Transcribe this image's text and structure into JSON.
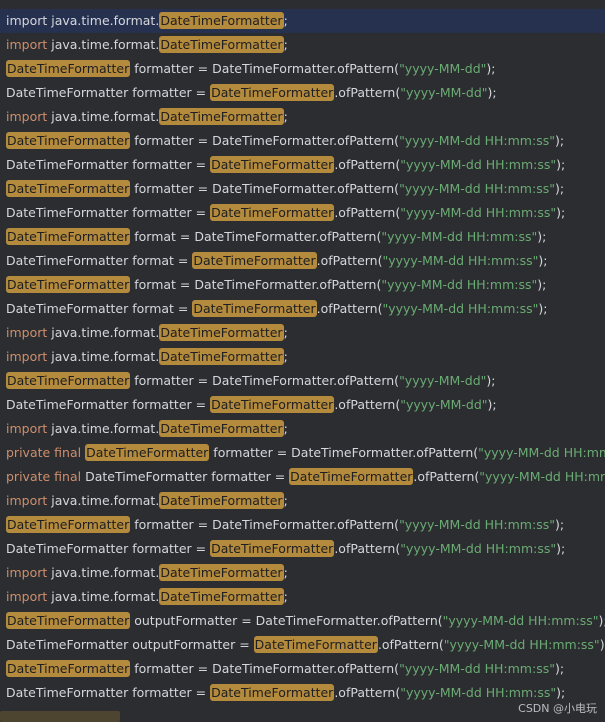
{
  "colors": {
    "background": "#2b2d30",
    "selection": "#263150",
    "keyword": "#cf8e6d",
    "plain": "#d4d7dc",
    "string": "#6aab73",
    "match_highlight": "#b48a3c"
  },
  "watermark": "CSDN @小电玩",
  "lines": [
    [
      {
        "t": "import java.time.format",
        "c": "plain"
      },
      {
        "t": ".",
        "c": "plain"
      },
      {
        "t": "DateTimeFormatter",
        "c": "hl"
      },
      {
        "t": ";",
        "c": "plain"
      }
    ],
    [
      {
        "t": "import",
        "c": "kw"
      },
      {
        "t": " java.time.format",
        "c": "plain"
      },
      {
        "t": ".",
        "c": "plain"
      },
      {
        "t": "DateTimeFormatter",
        "c": "hl"
      },
      {
        "t": ";",
        "c": "plain"
      }
    ],
    [
      {
        "t": "DateTimeFormatter",
        "c": "hl"
      },
      {
        "t": " formatter = DateTimeFormatter.ofPattern(",
        "c": "plain"
      },
      {
        "t": "\"yyyy-MM-dd\"",
        "c": "str"
      },
      {
        "t": ");",
        "c": "plain"
      }
    ],
    [
      {
        "t": "DateTimeFormatter formatter = ",
        "c": "plain"
      },
      {
        "t": "DateTimeFormatter",
        "c": "hl"
      },
      {
        "t": ".ofPattern(",
        "c": "plain"
      },
      {
        "t": "\"yyyy-MM-dd\"",
        "c": "str"
      },
      {
        "t": ");",
        "c": "plain"
      }
    ],
    [
      {
        "t": "import",
        "c": "kw"
      },
      {
        "t": " java.time.format",
        "c": "plain"
      },
      {
        "t": ".",
        "c": "plain"
      },
      {
        "t": "DateTimeFormatter",
        "c": "hl"
      },
      {
        "t": ";",
        "c": "plain"
      }
    ],
    [
      {
        "t": "DateTimeFormatter",
        "c": "hl"
      },
      {
        "t": " formatter = DateTimeFormatter.ofPattern(",
        "c": "plain"
      },
      {
        "t": "\"yyyy-MM-dd HH:mm:ss\"",
        "c": "str"
      },
      {
        "t": ");",
        "c": "plain"
      }
    ],
    [
      {
        "t": "DateTimeFormatter formatter = ",
        "c": "plain"
      },
      {
        "t": "DateTimeFormatter",
        "c": "hl"
      },
      {
        "t": ".ofPattern(",
        "c": "plain"
      },
      {
        "t": "\"yyyy-MM-dd HH:mm:ss\"",
        "c": "str"
      },
      {
        "t": ");",
        "c": "plain"
      }
    ],
    [
      {
        "t": "DateTimeFormatter",
        "c": "hl"
      },
      {
        "t": " formatter = DateTimeFormatter.ofPattern(",
        "c": "plain"
      },
      {
        "t": "\"yyyy-MM-dd HH:mm:ss\"",
        "c": "str"
      },
      {
        "t": ");",
        "c": "plain"
      }
    ],
    [
      {
        "t": "DateTimeFormatter formatter = ",
        "c": "plain"
      },
      {
        "t": "DateTimeFormatter",
        "c": "hl"
      },
      {
        "t": ".ofPattern(",
        "c": "plain"
      },
      {
        "t": "\"yyyy-MM-dd HH:mm:ss\"",
        "c": "str"
      },
      {
        "t": ");",
        "c": "plain"
      }
    ],
    [
      {
        "t": "DateTimeFormatter",
        "c": "hl"
      },
      {
        "t": " format = DateTimeFormatter.ofPattern(",
        "c": "plain"
      },
      {
        "t": "\"yyyy-MM-dd HH:mm:ss\"",
        "c": "str"
      },
      {
        "t": ");",
        "c": "plain"
      }
    ],
    [
      {
        "t": "DateTimeFormatter format = ",
        "c": "plain"
      },
      {
        "t": "DateTimeFormatter",
        "c": "hl"
      },
      {
        "t": ".ofPattern(",
        "c": "plain"
      },
      {
        "t": "\"yyyy-MM-dd HH:mm:ss\"",
        "c": "str"
      },
      {
        "t": ");",
        "c": "plain"
      }
    ],
    [
      {
        "t": "DateTimeFormatter",
        "c": "hl"
      },
      {
        "t": " format = DateTimeFormatter.ofPattern(",
        "c": "plain"
      },
      {
        "t": "\"yyyy-MM-dd HH:mm:ss\"",
        "c": "str"
      },
      {
        "t": ");",
        "c": "plain"
      }
    ],
    [
      {
        "t": "DateTimeFormatter format = ",
        "c": "plain"
      },
      {
        "t": "DateTimeFormatter",
        "c": "hl"
      },
      {
        "t": ".ofPattern(",
        "c": "plain"
      },
      {
        "t": "\"yyyy-MM-dd HH:mm:ss\"",
        "c": "str"
      },
      {
        "t": ");",
        "c": "plain"
      }
    ],
    [
      {
        "t": "import",
        "c": "kw"
      },
      {
        "t": " java.time.format",
        "c": "plain"
      },
      {
        "t": ".",
        "c": "plain"
      },
      {
        "t": "DateTimeFormatter",
        "c": "hl"
      },
      {
        "t": ";",
        "c": "plain"
      }
    ],
    [
      {
        "t": "import",
        "c": "kw"
      },
      {
        "t": " java.time.format",
        "c": "plain"
      },
      {
        "t": ".",
        "c": "plain"
      },
      {
        "t": "DateTimeFormatter",
        "c": "hl"
      },
      {
        "t": ";",
        "c": "plain"
      }
    ],
    [
      {
        "t": "DateTimeFormatter",
        "c": "hl"
      },
      {
        "t": " formatter = DateTimeFormatter.ofPattern(",
        "c": "plain"
      },
      {
        "t": "\"yyyy-MM-dd\"",
        "c": "str"
      },
      {
        "t": ");",
        "c": "plain"
      }
    ],
    [
      {
        "t": "DateTimeFormatter formatter = ",
        "c": "plain"
      },
      {
        "t": "DateTimeFormatter",
        "c": "hl"
      },
      {
        "t": ".ofPattern(",
        "c": "plain"
      },
      {
        "t": "\"yyyy-MM-dd\"",
        "c": "str"
      },
      {
        "t": ");",
        "c": "plain"
      }
    ],
    [
      {
        "t": "import",
        "c": "kw"
      },
      {
        "t": " java.time.format",
        "c": "plain"
      },
      {
        "t": ".",
        "c": "plain"
      },
      {
        "t": "DateTimeFormatter",
        "c": "hl"
      },
      {
        "t": ";",
        "c": "plain"
      }
    ],
    [
      {
        "t": "private final ",
        "c": "kw"
      },
      {
        "t": "DateTimeFormatter",
        "c": "hl"
      },
      {
        "t": " formatter = DateTimeFormatter.ofPattern(",
        "c": "plain"
      },
      {
        "t": "\"yyyy-MM-dd HH:mm:ss\"",
        "c": "str"
      },
      {
        "t": ");",
        "c": "plain"
      }
    ],
    [
      {
        "t": "private final ",
        "c": "kw"
      },
      {
        "t": "DateTimeFormatter formatter = ",
        "c": "plain"
      },
      {
        "t": "DateTimeFormatter",
        "c": "hl"
      },
      {
        "t": ".ofPattern(",
        "c": "plain"
      },
      {
        "t": "\"yyyy-MM-dd HH:mm:ss\"",
        "c": "str"
      },
      {
        "t": ");",
        "c": "plain"
      }
    ],
    [
      {
        "t": "import",
        "c": "kw"
      },
      {
        "t": " java.time.format",
        "c": "plain"
      },
      {
        "t": ".",
        "c": "plain"
      },
      {
        "t": "DateTimeFormatter",
        "c": "hl"
      },
      {
        "t": ";",
        "c": "plain"
      }
    ],
    [
      {
        "t": "DateTimeFormatter",
        "c": "hl"
      },
      {
        "t": " formatter = DateTimeFormatter.ofPattern(",
        "c": "plain"
      },
      {
        "t": "\"yyyy-MM-dd HH:mm:ss\"",
        "c": "str"
      },
      {
        "t": ");",
        "c": "plain"
      }
    ],
    [
      {
        "t": "DateTimeFormatter formatter = ",
        "c": "plain"
      },
      {
        "t": "DateTimeFormatter",
        "c": "hl"
      },
      {
        "t": ".ofPattern(",
        "c": "plain"
      },
      {
        "t": "\"yyyy-MM-dd HH:mm:ss\"",
        "c": "str"
      },
      {
        "t": ");",
        "c": "plain"
      }
    ],
    [
      {
        "t": "import",
        "c": "kw"
      },
      {
        "t": " java.time.format",
        "c": "plain"
      },
      {
        "t": ".",
        "c": "plain"
      },
      {
        "t": "DateTimeFormatter",
        "c": "hl"
      },
      {
        "t": ";",
        "c": "plain"
      }
    ],
    [
      {
        "t": "import",
        "c": "kw"
      },
      {
        "t": " java.time.format",
        "c": "plain"
      },
      {
        "t": ".",
        "c": "plain"
      },
      {
        "t": "DateTimeFormatter",
        "c": "hl"
      },
      {
        "t": ";",
        "c": "plain"
      }
    ],
    [
      {
        "t": "DateTimeFormatter",
        "c": "hl"
      },
      {
        "t": " outputFormatter = DateTimeFormatter.ofPattern(",
        "c": "plain"
      },
      {
        "t": "\"yyyy-MM-dd HH:mm:ss\"",
        "c": "str"
      },
      {
        "t": ");",
        "c": "plain"
      }
    ],
    [
      {
        "t": "DateTimeFormatter outputFormatter = ",
        "c": "plain"
      },
      {
        "t": "DateTimeFormatter",
        "c": "hl"
      },
      {
        "t": ".ofPattern(",
        "c": "plain"
      },
      {
        "t": "\"yyyy-MM-dd HH:mm:ss\"",
        "c": "str"
      },
      {
        "t": ");",
        "c": "plain"
      }
    ],
    [
      {
        "t": "DateTimeFormatter",
        "c": "hl"
      },
      {
        "t": " formatter = DateTimeFormatter.ofPattern(",
        "c": "plain"
      },
      {
        "t": "\"yyyy-MM-dd HH:mm:ss\"",
        "c": "str"
      },
      {
        "t": ");",
        "c": "plain"
      }
    ],
    [
      {
        "t": "DateTimeFormatter formatter = ",
        "c": "plain"
      },
      {
        "t": "DateTimeFormatter",
        "c": "hl"
      },
      {
        "t": ".ofPattern(",
        "c": "plain"
      },
      {
        "t": "\"yyyy-MM-dd HH:mm:ss\"",
        "c": "str"
      },
      {
        "t": ");",
        "c": "plain"
      }
    ]
  ]
}
